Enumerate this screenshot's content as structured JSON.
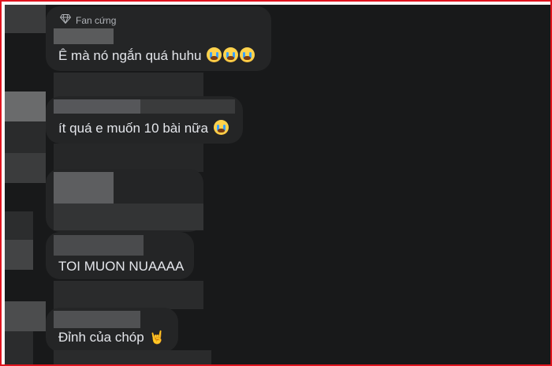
{
  "badge": {
    "icon": "diamond-icon",
    "label": "Fan cứng"
  },
  "comments": [
    {
      "text": "Ê mà nó ngắn quá huhu",
      "emoji": [
        "crying-face-icon",
        "crying-face-icon",
        "crying-face-icon"
      ]
    },
    {
      "text": "ít quá e muốn 10 bài nữa",
      "emoji": [
        "crying-face-icon"
      ]
    },
    {
      "text": "TOI MUON NUAAAA",
      "emoji": []
    },
    {
      "text": "Đỉnh của chóp",
      "emoji": [
        "rock-hand-icon"
      ]
    }
  ],
  "colors": {
    "background": "#18191a",
    "bubble": "#242526",
    "text": "#e4e6eb",
    "muted": "#b0b3b8",
    "border": "#e0141e"
  }
}
